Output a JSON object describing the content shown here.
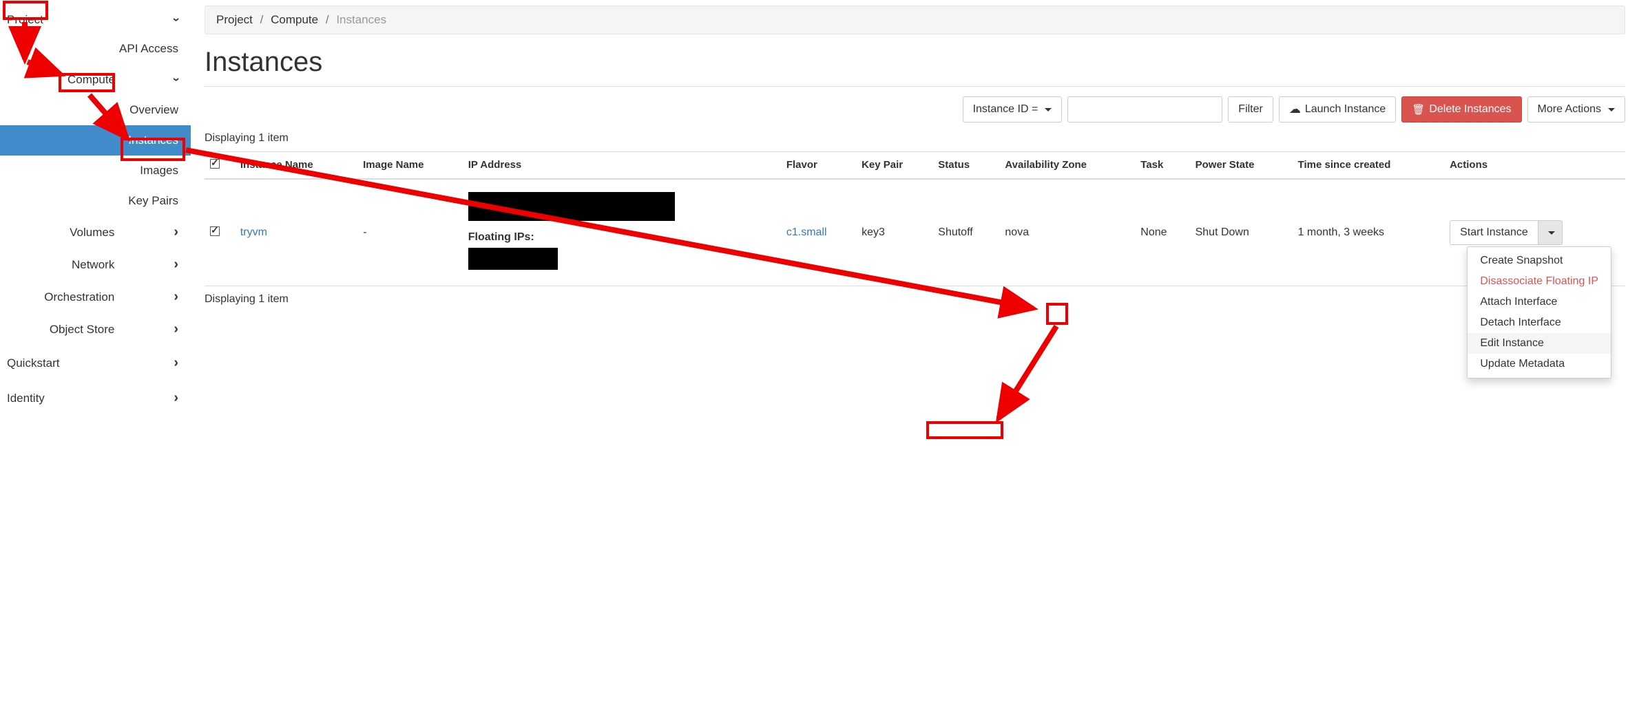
{
  "sidebar": {
    "project": "Project",
    "api_access": "API Access",
    "compute": "Compute",
    "overview": "Overview",
    "instances": "Instances",
    "images": "Images",
    "key_pairs": "Key Pairs",
    "volumes": "Volumes",
    "network": "Network",
    "orchestration": "Orchestration",
    "object_store": "Object Store",
    "quickstart": "Quickstart",
    "identity": "Identity"
  },
  "breadcrumbs": {
    "a": "Project",
    "b": "Compute",
    "c": "Instances"
  },
  "page_title": "Instances",
  "toolbar": {
    "filter_field": "Instance ID = ",
    "filter_btn": "Filter",
    "launch": "Launch Instance",
    "delete": "Delete Instances",
    "more": "More Actions "
  },
  "display_text_top": "Displaying 1 item",
  "display_text_bottom": "Displaying 1 item",
  "table": {
    "headers": {
      "instance_name": "Instance Name",
      "image_name": "Image Name",
      "ip_address": "IP Address",
      "flavor": "Flavor",
      "key_pair": "Key Pair",
      "status": "Status",
      "az": "Availability Zone",
      "task": "Task",
      "power": "Power State",
      "time": "Time since created",
      "actions": "Actions"
    },
    "row": {
      "instance_name": "tryvm",
      "image_name": "-",
      "floating_label": "Floating IPs:",
      "flavor": "c1.small",
      "key_pair": "key3",
      "status": "Shutoff",
      "az": "nova",
      "task": "None",
      "power": "Shut Down",
      "time": "1 month, 3 weeks",
      "action_primary": "Start Instance"
    }
  },
  "dropdown": {
    "create_snapshot": "Create Snapshot",
    "disassociate": "Disassociate Floating IP",
    "attach": "Attach Interface",
    "detach": "Detach Interface",
    "edit": "Edit Instance",
    "update_meta": "Update Metadata"
  }
}
